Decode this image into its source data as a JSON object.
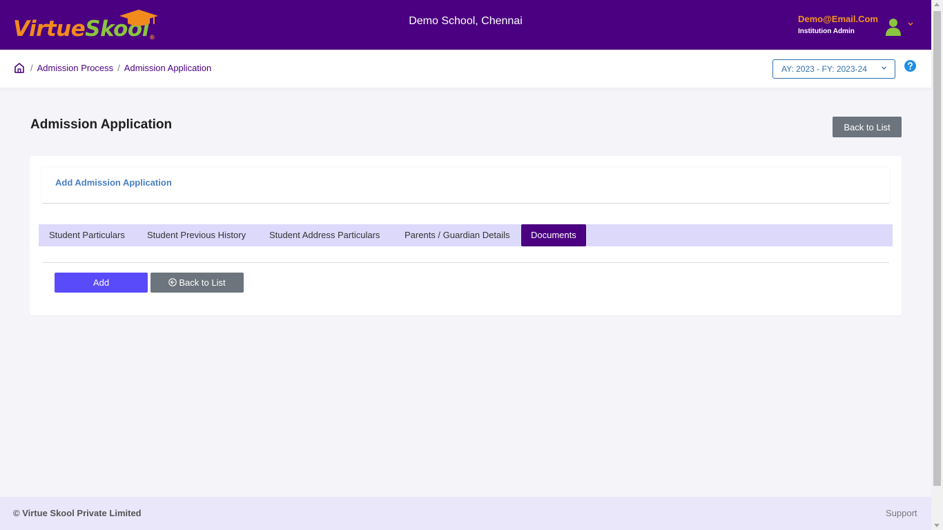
{
  "header": {
    "logo_word1": "Virtue",
    "logo_word2": "Skool",
    "logo_reg": "®",
    "school_name": "Demo School, Chennai",
    "user_email": "Demo@Email.Com",
    "user_role": "Institution Admin"
  },
  "breadcrumb": {
    "items": [
      "Admission Process",
      "Admission Application"
    ],
    "separator": "/"
  },
  "academic_year": {
    "selected": "AY: 2023 - FY: 2023-24"
  },
  "page": {
    "title": "Admission Application",
    "back_to_list_label": "Back to List"
  },
  "card": {
    "title": "Add Admission Application",
    "tabs": [
      {
        "label": "Student Particulars",
        "active": false
      },
      {
        "label": "Student Previous History",
        "active": false
      },
      {
        "label": "Student Address Particulars",
        "active": false
      },
      {
        "label": "Parents / Guardian Details",
        "active": false
      },
      {
        "label": "Documents",
        "active": true
      }
    ],
    "add_label": "Add",
    "back_label": "Back to List"
  },
  "footer": {
    "copyright": "© Virtue Skool Private Limited",
    "support": "Support"
  },
  "colors": {
    "header_bg": "#4a0080",
    "accent_orange": "#f28b1e",
    "accent_green": "#8bc53f",
    "tab_bar_bg": "#ddd9fb",
    "add_button": "#5a4bfa",
    "secondary_button": "#6c757d",
    "footer_bg": "#ebe7fb"
  },
  "icons": {
    "home": "home-icon",
    "help": "question-circle-icon",
    "avatar": "user-avatar-icon",
    "chevron": "chevron-down-icon",
    "back": "arrow-left-circle-icon"
  }
}
